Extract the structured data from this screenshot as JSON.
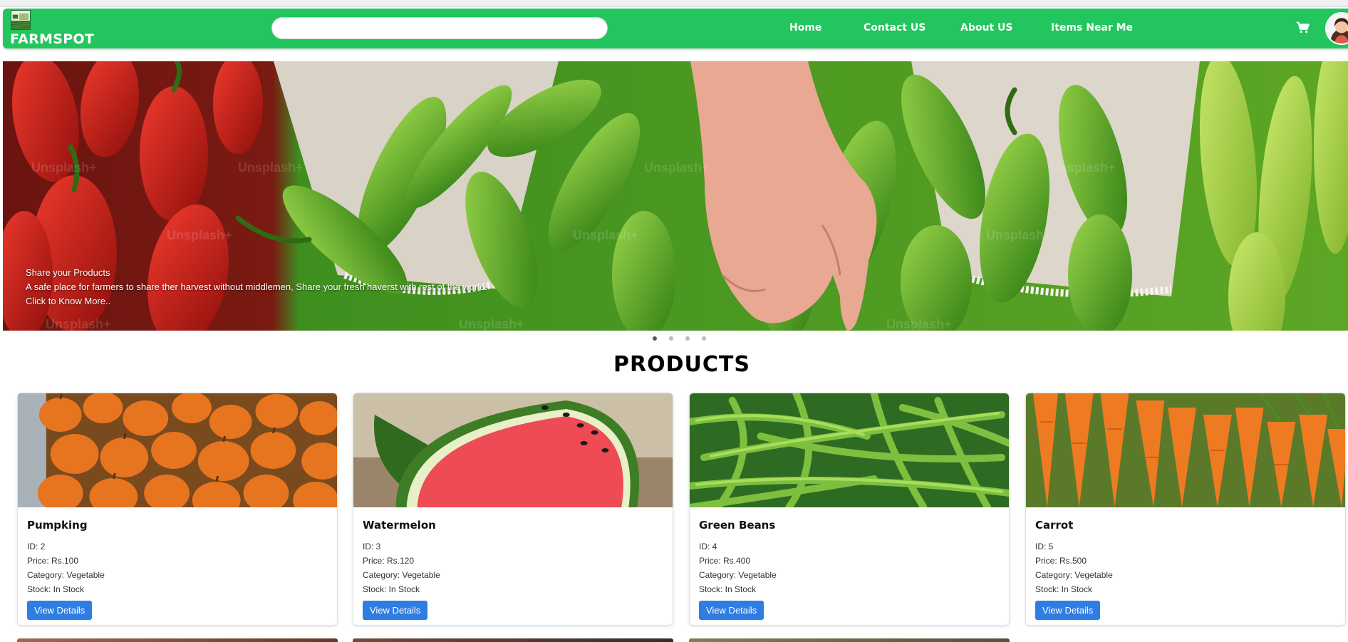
{
  "header": {
    "brand": "FARMSPOT",
    "search_placeholder": "",
    "nav": {
      "home": "Home",
      "contact": "Contact US",
      "about": "About US",
      "near": "Items Near Me"
    }
  },
  "hero": {
    "title": "Share your Products",
    "subtitle": "A safe place for farmers to share ther harvest without middlemen, Share your fresh haverst with rest of the world.",
    "cta": "Click to Know More..",
    "watermark": "Unsplash+",
    "slides": 4,
    "active_slide": 1
  },
  "products": {
    "heading": "PRODUCTS",
    "button_label": "View Details",
    "items": [
      {
        "name": "Pumpking",
        "id": "ID: 2",
        "price": "Price: Rs.100",
        "category": "Category: Vegetable",
        "stock": "Stock: In Stock"
      },
      {
        "name": "Watermelon",
        "id": "ID: 3",
        "price": "Price: Rs.120",
        "category": "Category: Vegetable",
        "stock": "Stock: In Stock"
      },
      {
        "name": "Green Beans",
        "id": "ID: 4",
        "price": "Price: Rs.400",
        "category": "Category: Vegetable",
        "stock": "Stock: In Stock"
      },
      {
        "name": "Carrot",
        "id": "ID: 5",
        "price": "Price: Rs.500",
        "category": "Category: Vegetable",
        "stock": "Stock: In Stock"
      }
    ]
  },
  "colors": {
    "navbar": "#22c55e",
    "button": "#2f7de1"
  },
  "icons": [
    "logo-icon",
    "cart-icon",
    "avatar-icon"
  ]
}
